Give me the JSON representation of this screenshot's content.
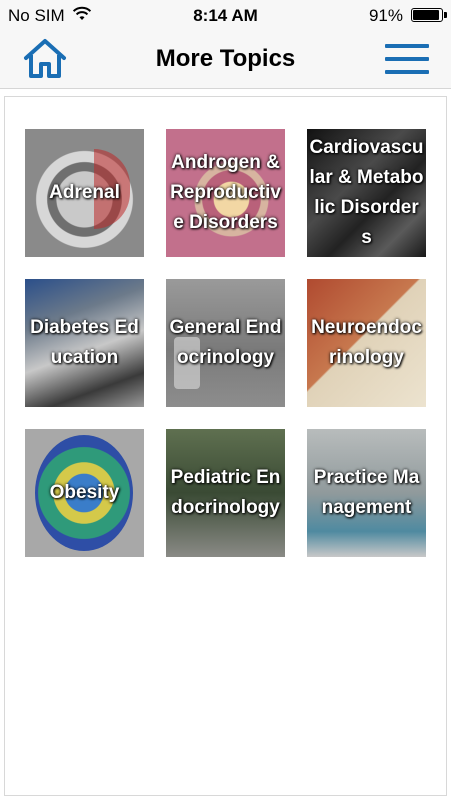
{
  "status_bar": {
    "carrier": "No SIM",
    "time": "8:14 AM",
    "battery": "91%"
  },
  "nav": {
    "title": "More Topics",
    "home_icon": "home-icon",
    "menu_icon": "hamburger-menu-icon",
    "accent_color": "#1a6eb4"
  },
  "topics": [
    {
      "label": "Adrenal",
      "bg": "#8f8f8f"
    },
    {
      "label": "Androgen & Reproductive Disorders",
      "bg": "#b36a86"
    },
    {
      "label": "Cardiovascular & Metabolic Disorders",
      "bg": "#2a2a2a"
    },
    {
      "label": "Diabetes Education",
      "bg": "#4c5a6c"
    },
    {
      "label": "General Endocrinology",
      "bg": "#7f7f7f"
    },
    {
      "label": "Neuroendocrinology",
      "bg": "#a8553a"
    },
    {
      "label": "Obesity",
      "bg": "#6f7a80"
    },
    {
      "label": "Pediatric Endocrinology",
      "bg": "#44563f"
    },
    {
      "label": "Practice Management",
      "bg": "#8c9aa0"
    }
  ]
}
